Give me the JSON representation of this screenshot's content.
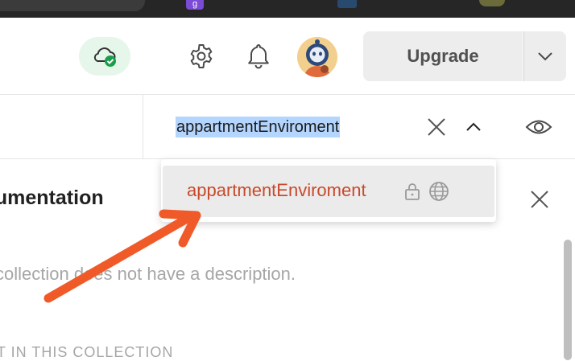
{
  "top_strip": {
    "tab_g_label": "g"
  },
  "header": {
    "sync_icon": "cloud-check-icon",
    "settings_icon": "gear-icon",
    "notifications_icon": "bell-icon",
    "avatar_icon": "user-avatar",
    "upgrade_label": "Upgrade",
    "upgrade_caret_icon": "chevron-down-icon"
  },
  "find_bar": {
    "query": "appartmentEnviroment",
    "clear_icon": "close-icon",
    "prev_icon": "chevron-up-icon",
    "view_icon": "eye-icon"
  },
  "autocomplete": {
    "items": [
      {
        "label": "appartmentEnviroment",
        "lock_icon": "lock-icon",
        "scope_icon": "globe-icon"
      }
    ]
  },
  "documentation": {
    "title": "cumentation",
    "description": "collection does not have a description.",
    "section_header": "T IN THIS COLLECTION",
    "close_icon": "close-icon"
  },
  "colors": {
    "accent": "#c8492b",
    "annotation_arrow": "#f05a28",
    "selection": "#b4d5fe",
    "sync_bg": "#e6f6ea"
  }
}
